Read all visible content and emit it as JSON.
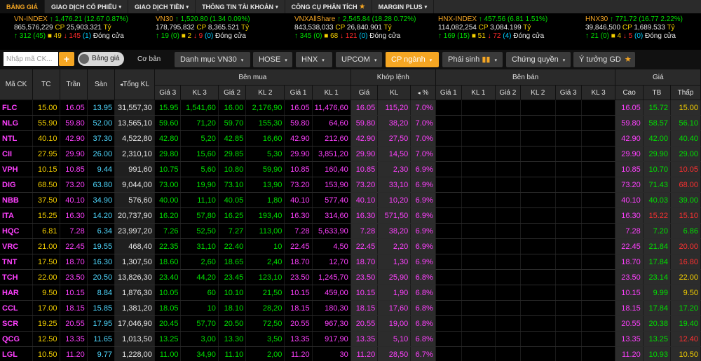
{
  "nav": [
    {
      "label": "BẢNG GIÁ",
      "active": true
    },
    {
      "label": "GIAO DỊCH CỔ PHIẾU",
      "caret": "▾"
    },
    {
      "label": "GIAO DỊCH TIỀN",
      "caret": "▾"
    },
    {
      "label": "THÔNG TIN TÀI KHOẢN",
      "caret": "▾"
    },
    {
      "label": "CÔNG CỤ PHÂN TÍCH",
      "star": "★"
    },
    {
      "label": "MARGIN PLUS",
      "caret": "▾"
    }
  ],
  "indices": [
    {
      "name": "VN-INDEX",
      "arrow": "↑",
      "value": "1,476.21",
      "change": "(12.67 0.87%)",
      "volume": "865,576,229",
      "cp": "CP",
      "amount": "25,903.321",
      "unit": "Tỷ",
      "up": "312",
      "upref": "(45)",
      "ref": "49",
      "down": "145",
      "downref": "(1)",
      "status": "Đóng cửa"
    },
    {
      "name": "VN30",
      "arrow": "↑",
      "value": "1,520.80",
      "change": "(1.34 0.09%)",
      "volume": "178,795,832",
      "cp": "CP",
      "amount": "8,365.521",
      "unit": "Tỷ",
      "up": "19",
      "upref": "(0)",
      "ref": "2",
      "down": "9",
      "downref": "(0)",
      "status": "Đóng cửa"
    },
    {
      "name": "VNXAllShare",
      "arrow": "↑",
      "value": "2,545.84",
      "change": "(18.28 0.72%)",
      "volume": "843,538,033",
      "cp": "CP",
      "amount": "26,840.901",
      "unit": "Tỷ",
      "up": "345",
      "upref": "(0)",
      "ref": "68",
      "down": "121",
      "downref": "(0)",
      "status": "Đóng cửa"
    },
    {
      "name": "HNX-INDEX",
      "arrow": "↑",
      "value": "457.56",
      "change": "(6.81 1.51%)",
      "volume": "114,082,254",
      "cp": "CP",
      "amount": "3,084.199",
      "unit": "Tỷ",
      "up": "169",
      "upref": "(15)",
      "ref": "51",
      "down": "72",
      "downref": "(4)",
      "status": "Đóng cửa"
    },
    {
      "name": "HNX30",
      "arrow": "↑",
      "value": "771.72",
      "change": "(16.77 2.22%)",
      "volume": "39,846,500",
      "cp": "CP",
      "amount": "1,689.533",
      "unit": "Tỷ",
      "up": "21",
      "upref": "(0)",
      "ref": "4",
      "down": "5",
      "downref": "(0)",
      "status": "Đóng cửa"
    }
  ],
  "toolbar": {
    "search_placeholder": "Nhập mã CK...",
    "add_label": "+",
    "toggle_label": "Bảng giá",
    "basic_label": "Cơ bản",
    "tabs": [
      {
        "label": "Danh mục VN30",
        "caret": "▾"
      },
      {
        "label": "HOSE",
        "caret": "▾"
      },
      {
        "label": "HNX",
        "caret": "▾"
      },
      {
        "label": "UPCOM",
        "caret": "▾"
      },
      {
        "label": "CP ngành",
        "caret": "▾",
        "active": true
      },
      {
        "label": "Phái sinh",
        "caret": "▾"
      },
      {
        "label": "Chứng quyền",
        "caret": "▾"
      },
      {
        "label": "Ý tưởng GD",
        "star": "★"
      }
    ]
  },
  "headers": {
    "group": [
      "Bên mua",
      "Khớp lệnh",
      "Bên bán",
      "Giá"
    ],
    "cols": [
      "Mã CK",
      "TC",
      "Trần",
      "Sàn",
      "Tổng KL",
      "Giá 3",
      "KL 3",
      "Giá 2",
      "KL 2",
      "Giá 1",
      "KL 1",
      "Giá",
      "KL",
      "%",
      "Giá 1",
      "KL 1",
      "Giá 2",
      "KL 2",
      "Giá 3",
      "KL 3",
      "Cao",
      "TB",
      "Thấp"
    ],
    "sort_tongkl": "◂",
    "sort_pct": "◂"
  },
  "rows": [
    {
      "sym": "FLC",
      "tc": "15.00",
      "tran": "16.05",
      "san": "13.95",
      "tkl": "31,557,30",
      "g3": "15.95",
      "k3": "1,541,60",
      "g2": "16.00",
      "k2": "2,176,90",
      "g1": "16.05",
      "k1": "11,476,60",
      "gia": "16.05",
      "kl": "115,20",
      "pct": "7.0%",
      "cao": "16.05",
      "tb": "15.72",
      "thap": "15.00"
    },
    {
      "sym": "NLG",
      "tc": "55.90",
      "tran": "59.80",
      "san": "52.00",
      "tkl": "13,565,10",
      "g3": "59.60",
      "k3": "71,20",
      "g2": "59.70",
      "k2": "155,30",
      "g1": "59.80",
      "k1": "64,60",
      "gia": "59.80",
      "kl": "38,20",
      "pct": "7.0%",
      "cao": "59.80",
      "tb": "58.57",
      "thap": "56.10"
    },
    {
      "sym": "NTL",
      "tc": "40.10",
      "tran": "42.90",
      "san": "37.30",
      "tkl": "4,522,80",
      "g3": "42.80",
      "k3": "5,20",
      "g2": "42.85",
      "k2": "16,60",
      "g1": "42.90",
      "k1": "212,60",
      "gia": "42.90",
      "kl": "27,50",
      "pct": "7.0%",
      "cao": "42.90",
      "tb": "42.00",
      "thap": "40.40"
    },
    {
      "sym": "CII",
      "tc": "27.95",
      "tran": "29.90",
      "san": "26.00",
      "tkl": "2,310,10",
      "g3": "29.80",
      "k3": "15,60",
      "g2": "29.85",
      "k2": "5,30",
      "g1": "29.90",
      "k1": "3,851,20",
      "gia": "29.90",
      "kl": "14,50",
      "pct": "7.0%",
      "cao": "29.90",
      "tb": "29.90",
      "thap": "29.00"
    },
    {
      "sym": "VPH",
      "tc": "10.15",
      "tran": "10.85",
      "san": "9.44",
      "tkl": "991,60",
      "g3": "10.75",
      "k3": "5,60",
      "g2": "10.80",
      "k2": "59,90",
      "g1": "10.85",
      "k1": "160,40",
      "gia": "10.85",
      "kl": "2,30",
      "pct": "6.9%",
      "cao": "10.85",
      "tb": "10.70",
      "thap": "10.05"
    },
    {
      "sym": "DIG",
      "tc": "68.50",
      "tran": "73.20",
      "san": "63.80",
      "tkl": "9,044,00",
      "g3": "73.00",
      "k3": "19,90",
      "g2": "73.10",
      "k2": "13,90",
      "g1": "73.20",
      "k1": "153,90",
      "gia": "73.20",
      "kl": "33,10",
      "pct": "6.9%",
      "cao": "73.20",
      "tb": "71.43",
      "thap": "68.00"
    },
    {
      "sym": "NBB",
      "tc": "37.50",
      "tran": "40.10",
      "san": "34.90",
      "tkl": "576,60",
      "g3": "40.00",
      "k3": "11,10",
      "g2": "40.05",
      "k2": "1,80",
      "g1": "40.10",
      "k1": "577,40",
      "gia": "40.10",
      "kl": "10,20",
      "pct": "6.9%",
      "cao": "40.10",
      "tb": "40.03",
      "thap": "39.00"
    },
    {
      "sym": "ITA",
      "tc": "15.25",
      "tran": "16.30",
      "san": "14.20",
      "tkl": "20,737,90",
      "g3": "16.20",
      "k3": "57,80",
      "g2": "16.25",
      "k2": "193,40",
      "g1": "16.30",
      "k1": "314,60",
      "gia": "16.30",
      "kl": "571,50",
      "pct": "6.9%",
      "cao": "16.30",
      "tb": "15.22",
      "thap": "15.10"
    },
    {
      "sym": "HQC",
      "tc": "6.81",
      "tran": "7.28",
      "san": "6.34",
      "tkl": "23,997,20",
      "g3": "7.26",
      "k3": "52,50",
      "g2": "7.27",
      "k2": "113,00",
      "g1": "7.28",
      "k1": "5,633,90",
      "gia": "7.28",
      "kl": "38,20",
      "pct": "6.9%",
      "cao": "7.28",
      "tb": "7.20",
      "thap": "6.86"
    },
    {
      "sym": "VRC",
      "tc": "21.00",
      "tran": "22.45",
      "san": "19.55",
      "tkl": "468,40",
      "g3": "22.35",
      "k3": "31,10",
      "g2": "22.40",
      "k2": "10",
      "g1": "22.45",
      "k1": "4,50",
      "gia": "22.45",
      "kl": "2,20",
      "pct": "6.9%",
      "cao": "22.45",
      "tb": "21.84",
      "thap": "20.00"
    },
    {
      "sym": "TNT",
      "tc": "17.50",
      "tran": "18.70",
      "san": "16.30",
      "tkl": "1,307,50",
      "g3": "18.60",
      "k3": "2,60",
      "g2": "18.65",
      "k2": "2,40",
      "g1": "18.70",
      "k1": "12,70",
      "gia": "18.70",
      "kl": "1,30",
      "pct": "6.9%",
      "cao": "18.70",
      "tb": "17.84",
      "thap": "16.80"
    },
    {
      "sym": "TCH",
      "tc": "22.00",
      "tran": "23.50",
      "san": "20.50",
      "tkl": "13,826,30",
      "g3": "23.40",
      "k3": "44,20",
      "g2": "23.45",
      "k2": "123,10",
      "g1": "23.50",
      "k1": "1,245,70",
      "gia": "23.50",
      "kl": "25,90",
      "pct": "6.8%",
      "cao": "23.50",
      "tb": "23.14",
      "thap": "22.00"
    },
    {
      "sym": "HAR",
      "tc": "9.50",
      "tran": "10.15",
      "san": "8.84",
      "tkl": "1,876,30",
      "g3": "10.05",
      "k3": "60",
      "g2": "10.10",
      "k2": "21,50",
      "g1": "10.15",
      "k1": "459,00",
      "gia": "10.15",
      "kl": "1,90",
      "pct": "6.8%",
      "cao": "10.15",
      "tb": "9.99",
      "thap": "9.50"
    },
    {
      "sym": "CCL",
      "tc": "17.00",
      "tran": "18.15",
      "san": "15.85",
      "tkl": "1,381,20",
      "g3": "18.05",
      "k3": "10",
      "g2": "18.10",
      "k2": "28,20",
      "g1": "18.15",
      "k1": "180,30",
      "gia": "18.15",
      "kl": "17,60",
      "pct": "6.8%",
      "cao": "18.15",
      "tb": "17.84",
      "thap": "17.20"
    },
    {
      "sym": "SCR",
      "tc": "19.25",
      "tran": "20.55",
      "san": "17.95",
      "tkl": "17,046,90",
      "g3": "20.45",
      "k3": "57,70",
      "g2": "20.50",
      "k2": "72,50",
      "g1": "20.55",
      "k1": "967,30",
      "gia": "20.55",
      "kl": "19,00",
      "pct": "6.8%",
      "cao": "20.55",
      "tb": "20.38",
      "thap": "19.40"
    },
    {
      "sym": "QCG",
      "tc": "12.50",
      "tran": "13.35",
      "san": "11.65",
      "tkl": "1,013,50",
      "g3": "13.25",
      "k3": "3,00",
      "g2": "13.30",
      "k2": "3,50",
      "g1": "13.35",
      "k1": "917,90",
      "gia": "13.35",
      "kl": "5,10",
      "pct": "6.8%",
      "cao": "13.35",
      "tb": "13.25",
      "thap": "12.40"
    },
    {
      "sym": "LGL",
      "tc": "10.50",
      "tran": "11.20",
      "san": "9.77",
      "tkl": "1,228,00",
      "g3": "11.00",
      "k3": "34,90",
      "g2": "11.10",
      "k2": "2,00",
      "g1": "11.20",
      "k1": "30",
      "gia": "11.20",
      "kl": "28,50",
      "pct": "6.7%",
      "cao": "11.20",
      "tb": "10.93",
      "thap": "10.50"
    }
  ],
  "colors": {
    "ceiling": "#ff40ff",
    "reference": "#f5d000",
    "floor": "#4fd8ff",
    "up": "#00e000",
    "down": "#ff3030",
    "accent": "#f5a623"
  }
}
